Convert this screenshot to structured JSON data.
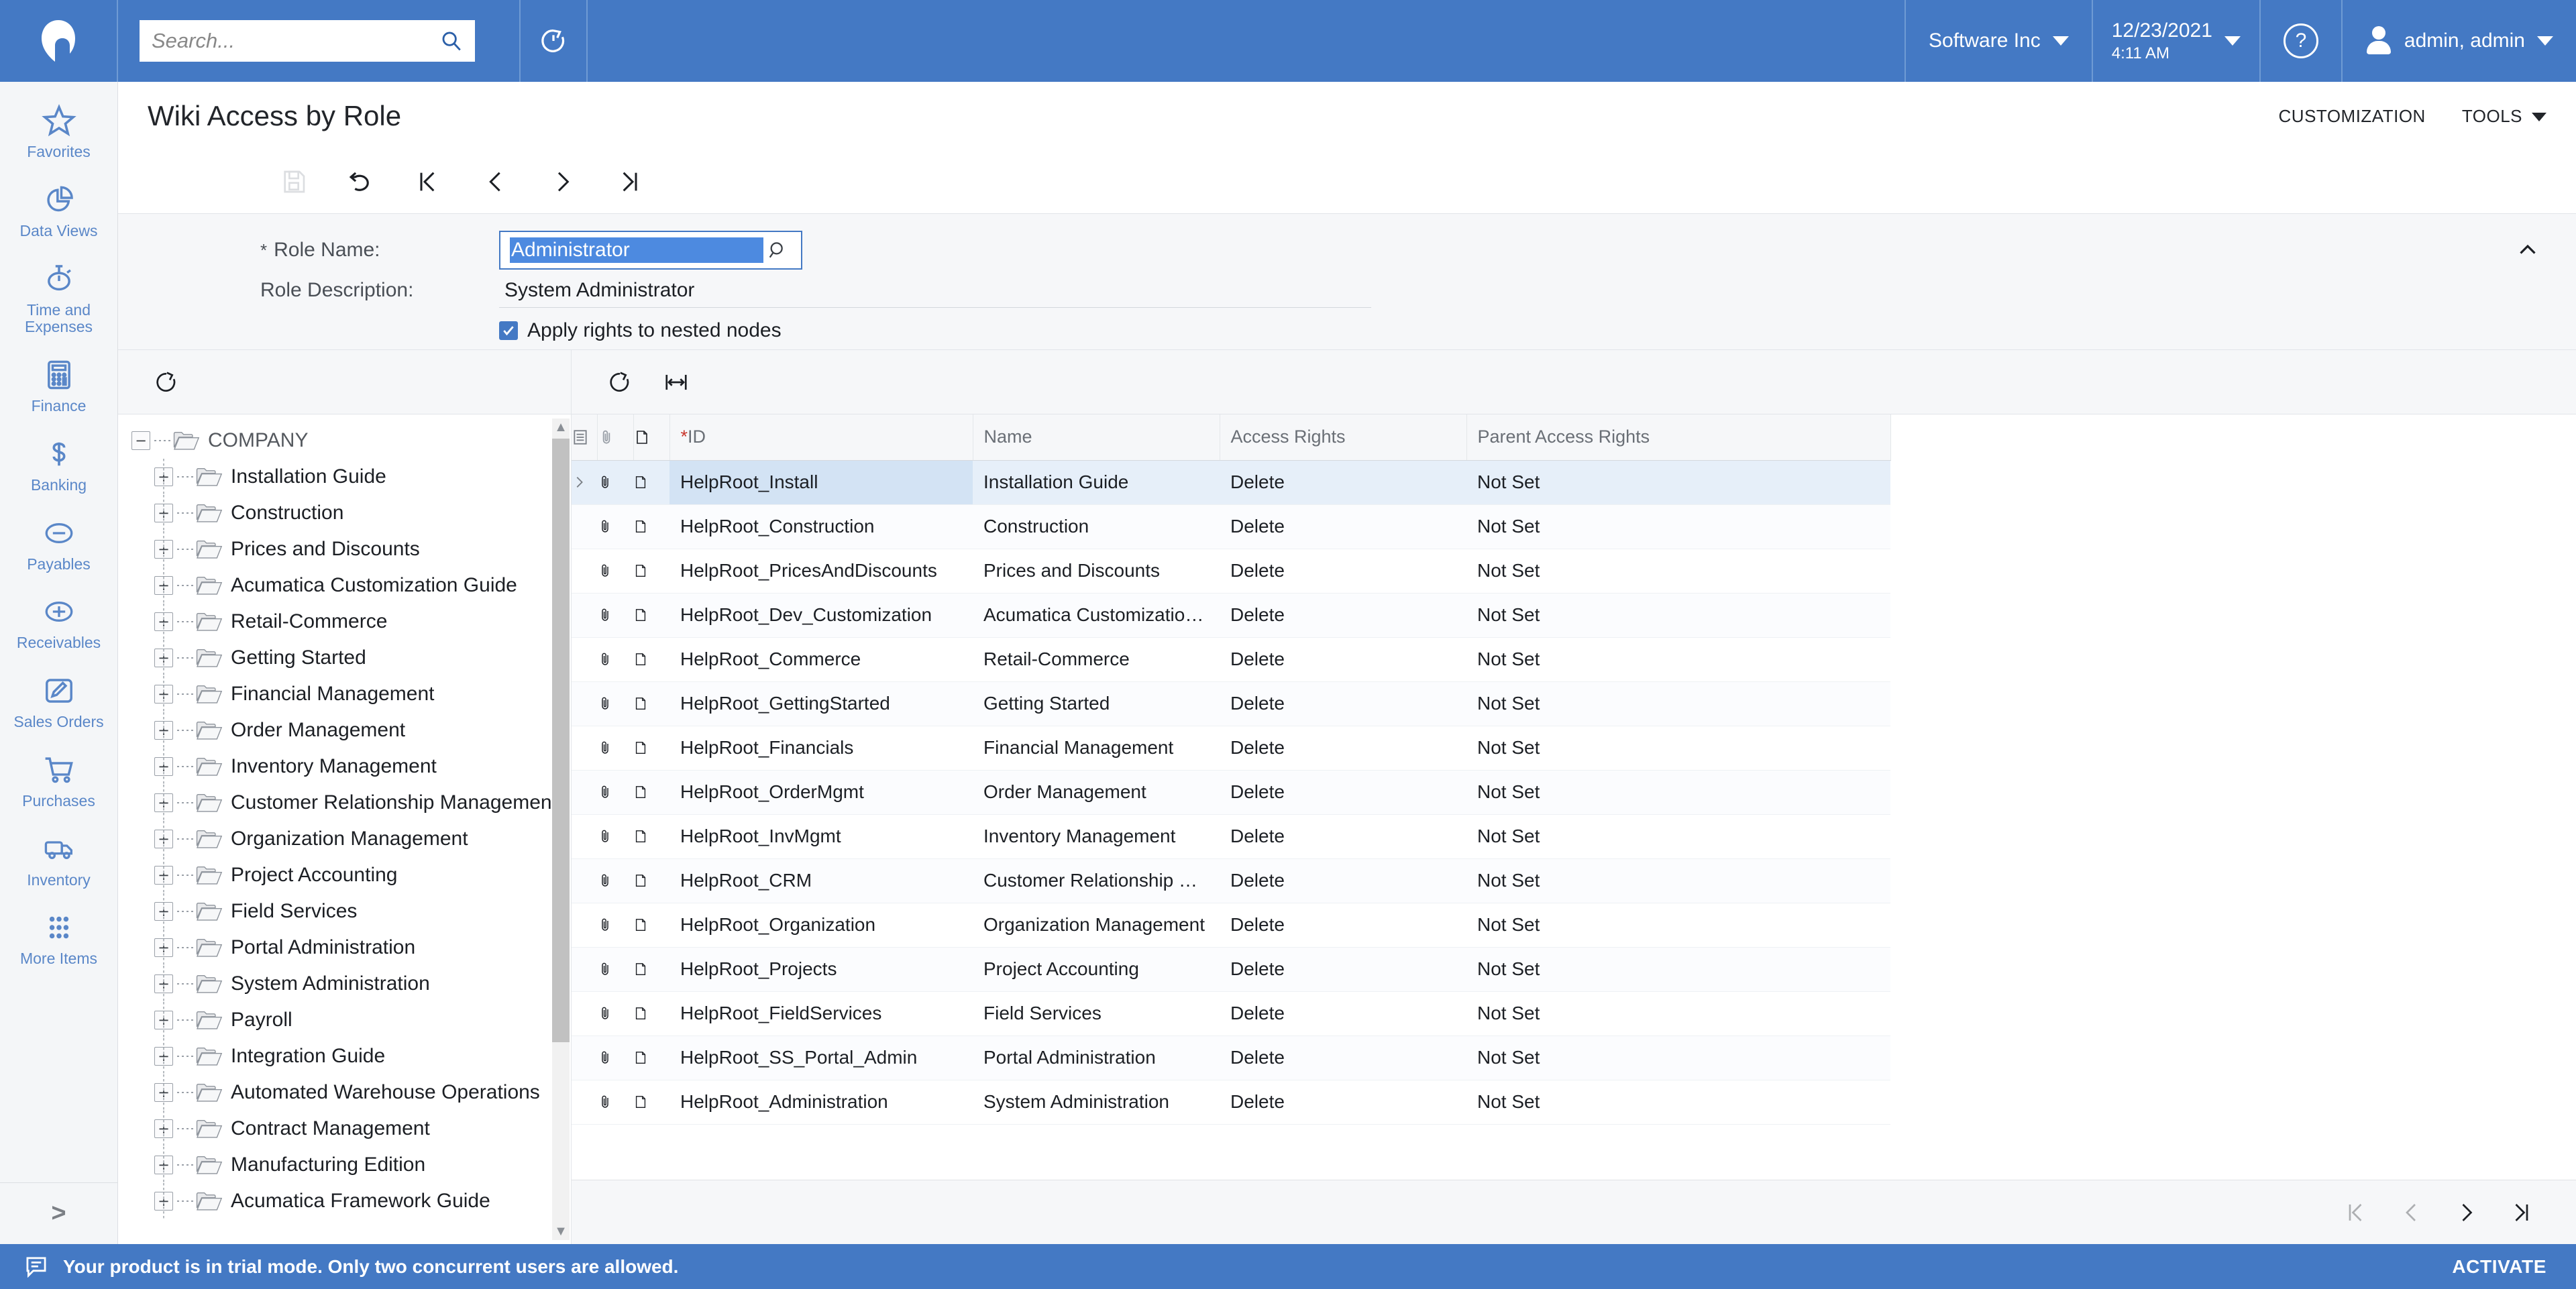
{
  "header": {
    "logo_name": "acumatica-logo",
    "search_placeholder": "Search...",
    "search_value": "",
    "refresh_icon": "refresh-clock-icon",
    "company": "Software Inc",
    "date": "12/23/2021",
    "time": "4:11 AM",
    "help_icon": "help-circle-icon",
    "user": "admin, admin"
  },
  "nav": {
    "items": [
      {
        "label": "Favorites",
        "icon": "star-icon"
      },
      {
        "label": "Data Views",
        "icon": "pie-chart-icon"
      },
      {
        "label": "Time and Expenses",
        "icon": "stopwatch-icon"
      },
      {
        "label": "Finance",
        "icon": "calculator-icon"
      },
      {
        "label": "Banking",
        "icon": "dollar-icon"
      },
      {
        "label": "Payables",
        "icon": "minus-circle-icon"
      },
      {
        "label": "Receivables",
        "icon": "plus-circle-icon"
      },
      {
        "label": "Sales Orders",
        "icon": "pencil-square-icon"
      },
      {
        "label": "Purchases",
        "icon": "shopping-cart-icon"
      },
      {
        "label": "Inventory",
        "icon": "truck-icon"
      },
      {
        "label": "More Items",
        "icon": "grid-dots-icon"
      }
    ],
    "expand_label": ">"
  },
  "page": {
    "title": "Wiki Access by Role",
    "customization_label": "CUSTOMIZATION",
    "tools_label": "TOOLS"
  },
  "toolbar": {
    "buttons": [
      {
        "name": "save-button",
        "icon": "floppy-disk-icon",
        "disabled": true
      },
      {
        "name": "undo-button",
        "icon": "undo-arrow-icon",
        "disabled": false
      },
      {
        "name": "first-record-button",
        "icon": "first-page-icon",
        "disabled": false
      },
      {
        "name": "previous-record-button",
        "icon": "chevron-left-icon",
        "disabled": false
      },
      {
        "name": "next-record-button",
        "icon": "chevron-right-icon",
        "disabled": false
      },
      {
        "name": "last-record-button",
        "icon": "last-page-icon",
        "disabled": false
      }
    ]
  },
  "form": {
    "role_name_label": "Role Name:",
    "role_name_required": "*",
    "role_name_value": "Administrator",
    "role_description_label": "Role Description:",
    "role_description_value": "System Administrator",
    "apply_nested_label": "Apply rights to nested nodes",
    "apply_nested_checked": true,
    "collapse_icon": "chevron-up-icon"
  },
  "tree": {
    "refresh_icon": "refresh-icon",
    "root": "COMPANY",
    "nodes": [
      "Installation Guide",
      "Construction",
      "Prices and Discounts",
      "Acumatica Customization Guide",
      "Retail-Commerce",
      "Getting Started",
      "Financial Management",
      "Order Management",
      "Inventory Management",
      "Customer Relationship Management",
      "Organization Management",
      "Project Accounting",
      "Field Services",
      "Portal Administration",
      "System Administration",
      "Payroll",
      "Integration Guide",
      "Automated Warehouse Operations",
      "Contract Management",
      "Manufacturing Edition",
      "Acumatica Framework Guide"
    ]
  },
  "grid": {
    "toolbar": [
      {
        "name": "grid-refresh-button",
        "icon": "refresh-icon"
      },
      {
        "name": "fit-columns-button",
        "icon": "fit-width-icon"
      }
    ],
    "columns": [
      {
        "label": "",
        "icon": "column-config-icon",
        "type": "icon"
      },
      {
        "label": "",
        "icon": "paperclip-icon",
        "type": "icon"
      },
      {
        "label": "",
        "icon": "note-page-icon",
        "type": "icon"
      },
      {
        "label": "ID",
        "required": "*",
        "type": "text"
      },
      {
        "label": "Name",
        "type": "text"
      },
      {
        "label": "Access Rights",
        "type": "text"
      },
      {
        "label": "Parent Access Rights",
        "type": "text"
      }
    ],
    "rows": [
      {
        "id": "HelpRoot_Install",
        "name": "Installation Guide",
        "access": "Delete",
        "parent": "Not Set",
        "selected": true
      },
      {
        "id": "HelpRoot_Construction",
        "name": "Construction",
        "access": "Delete",
        "parent": "Not Set",
        "selected": false
      },
      {
        "id": "HelpRoot_PricesAndDiscounts",
        "name": "Prices and Discounts",
        "access": "Delete",
        "parent": "Not Set",
        "selected": false
      },
      {
        "id": "HelpRoot_Dev_Customization",
        "name": "Acumatica Customization Gu…",
        "access": "Delete",
        "parent": "Not Set",
        "selected": false
      },
      {
        "id": "HelpRoot_Commerce",
        "name": "Retail-Commerce",
        "access": "Delete",
        "parent": "Not Set",
        "selected": false
      },
      {
        "id": "HelpRoot_GettingStarted",
        "name": "Getting Started",
        "access": "Delete",
        "parent": "Not Set",
        "selected": false
      },
      {
        "id": "HelpRoot_Financials",
        "name": "Financial Management",
        "access": "Delete",
        "parent": "Not Set",
        "selected": false
      },
      {
        "id": "HelpRoot_OrderMgmt",
        "name": "Order Management",
        "access": "Delete",
        "parent": "Not Set",
        "selected": false
      },
      {
        "id": "HelpRoot_InvMgmt",
        "name": "Inventory Management",
        "access": "Delete",
        "parent": "Not Set",
        "selected": false
      },
      {
        "id": "HelpRoot_CRM",
        "name": "Customer Relationship Mana…",
        "access": "Delete",
        "parent": "Not Set",
        "selected": false
      },
      {
        "id": "HelpRoot_Organization",
        "name": "Organization Management",
        "access": "Delete",
        "parent": "Not Set",
        "selected": false
      },
      {
        "id": "HelpRoot_Projects",
        "name": "Project Accounting",
        "access": "Delete",
        "parent": "Not Set",
        "selected": false
      },
      {
        "id": "HelpRoot_FieldServices",
        "name": "Field Services",
        "access": "Delete",
        "parent": "Not Set",
        "selected": false
      },
      {
        "id": "HelpRoot_SS_Portal_Admin",
        "name": "Portal Administration",
        "access": "Delete",
        "parent": "Not Set",
        "selected": false
      },
      {
        "id": "HelpRoot_Administration",
        "name": "System Administration",
        "access": "Delete",
        "parent": "Not Set",
        "selected": false
      }
    ],
    "pagination": [
      {
        "name": "first-page-button",
        "icon": "first-page-icon",
        "disabled": true
      },
      {
        "name": "previous-page-button",
        "icon": "chevron-left-icon",
        "disabled": true
      },
      {
        "name": "next-page-button",
        "icon": "chevron-right-icon",
        "disabled": false
      },
      {
        "name": "last-page-button",
        "icon": "last-page-icon",
        "disabled": false
      }
    ]
  },
  "status": {
    "icon": "message-icon",
    "message": "Your product is in trial mode. Only two concurrent users are allowed.",
    "activate_label": "ACTIVATE"
  },
  "colors": {
    "brand_blue": "#4479c4",
    "nav_text": "#5a87c8",
    "selection_blue": "#4d8ae0",
    "row_selected": "#e6eff9"
  }
}
